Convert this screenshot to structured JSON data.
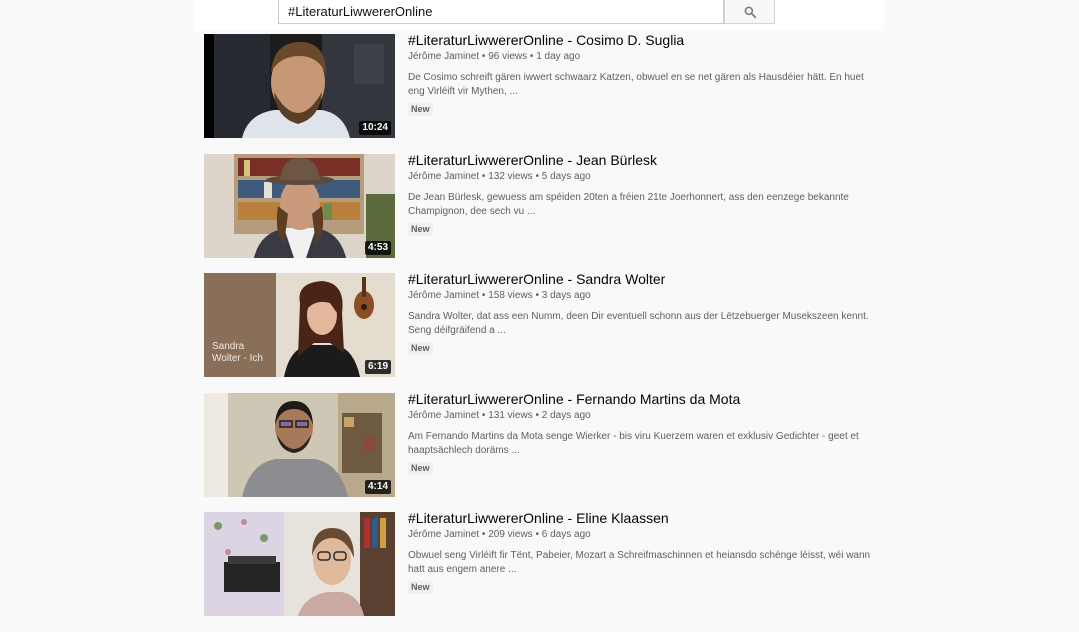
{
  "search": {
    "query": "#LiteraturLiwwererOnline",
    "icon": "search-icon"
  },
  "results": [
    {
      "title": "#LiteraturLiwwererOnline - Cosimo D. Suglia",
      "channel": "Jérôme Jaminet",
      "views": "96 views",
      "age": "1 day ago",
      "description": "De Cosimo schreift gären iwwert schwaarz Katzen, obwuel en se net gären als Hausdéier hätt. En huet eng Virléift vir Mythen, ...",
      "badge": "New",
      "duration": "10:24"
    },
    {
      "title": "#LiteraturLiwwererOnline - Jean Bürlesk",
      "channel": "Jérôme Jaminet",
      "views": "132 views",
      "age": "5 days ago",
      "description": "De Jean Bürlesk, gewuess am spéiden 20ten a fréien 21te Joerhonnert, ass den eenzege bekannte Champignon, dee sech vu ...",
      "badge": "New",
      "duration": "4:53"
    },
    {
      "title": "#LiteraturLiwwererOnline - Sandra Wolter",
      "channel": "Jérôme Jaminet",
      "views": "158 views",
      "age": "3 days ago",
      "description": "Sandra Wolter, dat ass een Numm, deen Dir eventuell schonn aus der Lëtzebuerger Musekszeen kennt. Seng déifgräifend a ...",
      "badge": "New",
      "duration": "6:19",
      "thumb_caption": "Sandra\nWolter - Ich"
    },
    {
      "title": "#LiteraturLiwwererOnline - Fernando Martins da Mota",
      "channel": "Jérôme Jaminet",
      "views": "131 views",
      "age": "2 days ago",
      "description": "Am Fernando Martins da Mota senge Wierker - bis viru Kuerzem waren et exklusiv Gedichter - geet et haaptsächlech doräms ...",
      "badge": "New",
      "duration": "4:14"
    },
    {
      "title": "#LiteraturLiwwererOnline - Eline Klaassen",
      "channel": "Jérôme Jaminet",
      "views": "209 views",
      "age": "6 days ago",
      "description": "Obwuel seng Virléift fir Tënt, Pabeier, Mozart a Schreifmaschinnen et heiansdo schénge léisst, wéi wann hatt aus engem anere ...",
      "badge": "New"
    }
  ],
  "separator": "•"
}
